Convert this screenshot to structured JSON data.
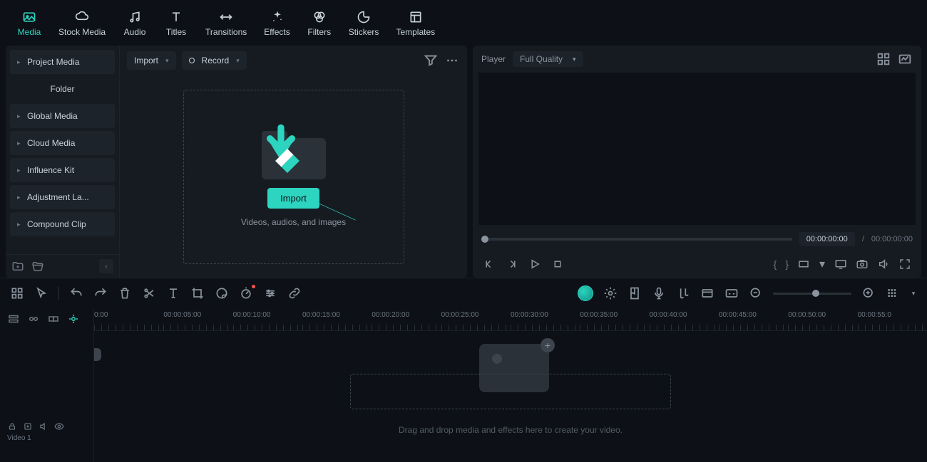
{
  "topnav": [
    {
      "label": "Media",
      "active": true,
      "icon": "image"
    },
    {
      "label": "Stock Media",
      "icon": "cloud"
    },
    {
      "label": "Audio",
      "icon": "music"
    },
    {
      "label": "Titles",
      "icon": "text"
    },
    {
      "label": "Transitions",
      "icon": "swap"
    },
    {
      "label": "Effects",
      "icon": "sparkle"
    },
    {
      "label": "Filters",
      "icon": "filter"
    },
    {
      "label": "Stickers",
      "icon": "sticker"
    },
    {
      "label": "Templates",
      "icon": "template"
    }
  ],
  "sidebar": {
    "items": [
      {
        "label": "Project Media",
        "expandable": true
      },
      {
        "label": "Folder",
        "folder": true
      },
      {
        "label": "Global Media",
        "expandable": true
      },
      {
        "label": "Cloud Media",
        "expandable": true
      },
      {
        "label": "Influence Kit",
        "expandable": true
      },
      {
        "label": "Adjustment La...",
        "expandable": true
      },
      {
        "label": "Compound Clip",
        "expandable": true
      }
    ]
  },
  "media_toolbar": {
    "import": "Import",
    "record": "Record"
  },
  "dropzone": {
    "button": "Import",
    "hint": "Videos, audios, and images"
  },
  "player": {
    "label": "Player",
    "quality": "Full Quality",
    "time_current": "00:00:00:00",
    "time_sep": "/",
    "time_total": "00:00:00:00"
  },
  "timeline": {
    "ruler": [
      "0:00",
      "00:00:05:00",
      "00:00:10:00",
      "00:00:15:00",
      "00:00:20:00",
      "00:00:25:00",
      "00:00:30:00",
      "00:00:35:00",
      "00:00:40:00",
      "00:00:45:00",
      "00:00:50:00",
      "00:00:55:0"
    ],
    "track_name": "Video 1",
    "hint": "Drag and drop media and effects here to create your video."
  }
}
